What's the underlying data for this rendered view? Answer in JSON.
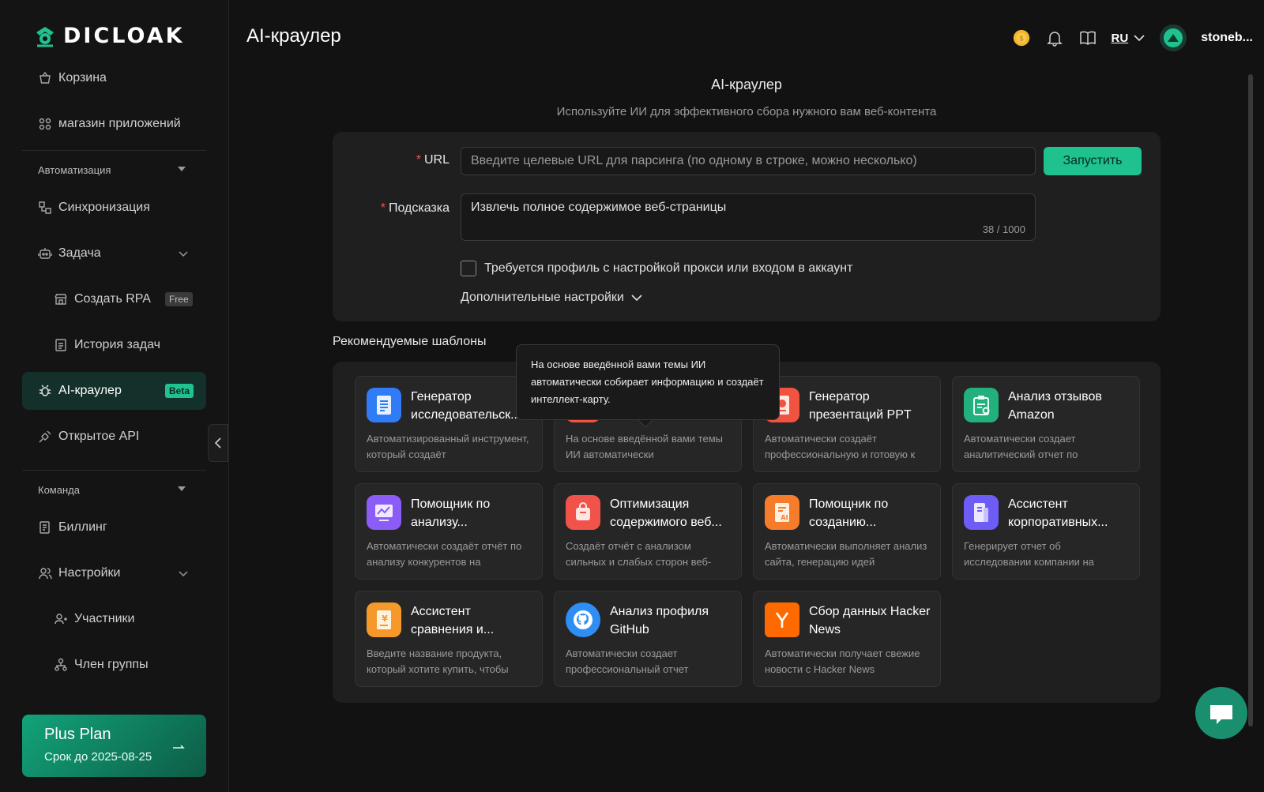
{
  "brand": {
    "name": "DICLOAK"
  },
  "sidebar": {
    "items": [
      {
        "label": "Корзина"
      },
      {
        "label": "магазин приложений"
      }
    ],
    "automation": {
      "heading": "Автоматизация",
      "sync": "Синхронизация",
      "task": "Задача",
      "create_rpa": "Создать RPA",
      "create_rpa_badge": "Free",
      "task_history": "История задач",
      "ai_crawler": "AI-краулер",
      "ai_crawler_badge": "Beta",
      "open_api": "Открытое API"
    },
    "team": {
      "heading": "Команда",
      "billing": "Биллинг",
      "settings": "Настройки",
      "members": "Участники",
      "group_member": "Член группы"
    },
    "plan": {
      "title": "Plus Plan",
      "expiry": "Срок до 2025-08-25"
    }
  },
  "header": {
    "title": "AI-краулер",
    "language": "RU",
    "username": "stoneb..."
  },
  "main": {
    "title": "AI-краулер",
    "subtitle": "Используйте ИИ для эффективного сбора нужного вам веб-контента",
    "form": {
      "url_label": "URL",
      "url_placeholder": "Введите целевые URL для парсинга (по одному в строке, можно несколько)",
      "run_button": "Запустить",
      "hint_label": "Подсказка",
      "hint_value": "Извлечь полное содержимое веб-страницы",
      "hint_counter": "38 / 1000",
      "proxy_checkbox": "Требуется профиль с настройкой прокси или входом в аккаунт",
      "advanced": "Дополнительные настройки"
    },
    "templates_title": "Рекомендуемые шаблоны",
    "templates": [
      {
        "name": "Генератор исследовательск...",
        "desc": "Автоматизированный инструмент, который создаёт",
        "color": "#2f7cf6"
      },
      {
        "name": "",
        "desc": "На основе введённой вами темы ИИ автоматически",
        "color": "#f0533f"
      },
      {
        "name": "Генератор презентаций PPT",
        "desc": "Автоматически создаёт профессиональную и готовую к",
        "color": "#f0533f"
      },
      {
        "name": "Анализ отзывов Amazon",
        "desc": "Автоматически создает аналитический отчет по",
        "color": "#22b07d"
      },
      {
        "name": "Помощник по анализу...",
        "desc": "Автоматически создаёт отчёт по анализу конкурентов на",
        "color": "#8b5cf6"
      },
      {
        "name": "Оптимизация содержимого веб...",
        "desc": "Создаёт отчёт с анализом сильных и слабых сторон веб-",
        "color": "#f0534a"
      },
      {
        "name": "Помощник по созданию...",
        "desc": "Автоматически выполняет анализ сайта, генерацию идей",
        "color": "#f47c2a"
      },
      {
        "name": "Ассистент корпоративных...",
        "desc": "Генерирует отчет об исследовании компании на",
        "color": "#6d5cf6"
      },
      {
        "name": "Ассистент сравнения и...",
        "desc": "Введите название продукта, который хотите купить, чтобы",
        "color": "#f59a2a"
      },
      {
        "name": "Анализ профиля GitHub",
        "desc": "Автоматически создает профессиональный отчет",
        "color": "#2f8ef6"
      },
      {
        "name": "Сбор данных Hacker News",
        "desc": "Автоматически получает свежие новости с Hacker News",
        "color": "#ff6a00"
      }
    ],
    "tooltip": "На основе введённой вами темы ИИ автоматически собирает информацию и создаёт интеллект-карту."
  },
  "icons": {
    "accent": "#1fc28f"
  }
}
